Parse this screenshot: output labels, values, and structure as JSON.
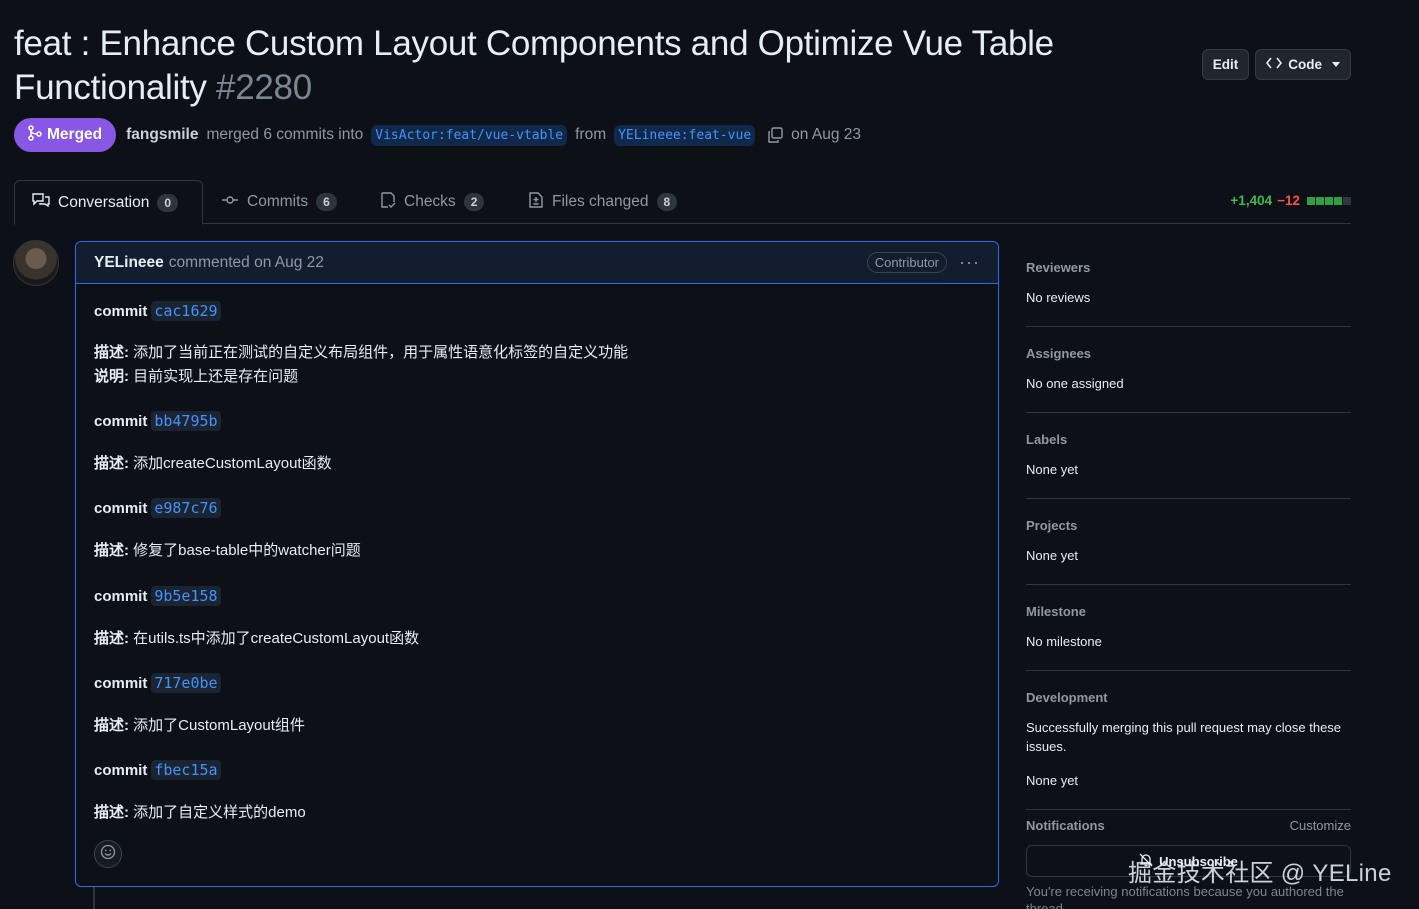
{
  "header": {
    "title": "feat : Enhance Custom Layout Components and Optimize Vue Table Functionality",
    "number": "#2280",
    "edit_label": "Edit",
    "code_label": "Code"
  },
  "meta": {
    "state": "Merged",
    "author": "fangsmile",
    "merged_text": "merged 6 commits into",
    "base_branch": "VisActor:feat/vue-vtable",
    "from_text": "from",
    "head_branch": "YELineee:feat-vue",
    "date_text": "on Aug 23"
  },
  "tabs": [
    {
      "label": "Conversation",
      "count": "0"
    },
    {
      "label": "Commits",
      "count": "6"
    },
    {
      "label": "Checks",
      "count": "2"
    },
    {
      "label": "Files changed",
      "count": "8"
    }
  ],
  "diffstat": {
    "additions": "+1,404",
    "deletions": "−12"
  },
  "comment": {
    "author": "YELineee",
    "action": "commented on Aug 22",
    "role": "Contributor",
    "commit_label": "commit",
    "desc_label": "描述:",
    "note_label": "说明:",
    "commits": [
      {
        "sha": "cac1629",
        "desc": "添加了当前正在测试的自定义布局组件，用于属性语意化标签的自定义功能",
        "note": "目前实现上还是存在问题"
      },
      {
        "sha": "bb4795b",
        "desc": "添加createCustomLayout函数"
      },
      {
        "sha": "e987c76",
        "desc": "修复了base-table中的watcher问题"
      },
      {
        "sha": "9b5e158",
        "desc": "在utils.ts中添加了createCustomLayout函数"
      },
      {
        "sha": "717e0be",
        "desc": "添加了CustomLayout组件"
      },
      {
        "sha": "fbec15a",
        "desc": "添加了自定义样式的demo"
      }
    ]
  },
  "sidebar": {
    "reviewers": {
      "title": "Reviewers",
      "value": "No reviews"
    },
    "assignees": {
      "title": "Assignees",
      "value": "No one assigned"
    },
    "labels": {
      "title": "Labels",
      "value": "None yet"
    },
    "projects": {
      "title": "Projects",
      "value": "None yet"
    },
    "milestone": {
      "title": "Milestone",
      "value": "No milestone"
    },
    "development": {
      "title": "Development",
      "text": "Successfully merging this pull request may close these issues.",
      "value": "None yet"
    },
    "notifications": {
      "title": "Notifications",
      "customize": "Customize",
      "button": "Unsubscribe",
      "note": "You're receiving notifications because you authored the thread."
    }
  },
  "watermark": "掘金技术社区 @ YELine",
  "colors": {
    "merged": "#8957e5",
    "link": "#4493f8",
    "additions": "#3fb950",
    "deletions": "#f85149",
    "background": "#0d1117"
  }
}
